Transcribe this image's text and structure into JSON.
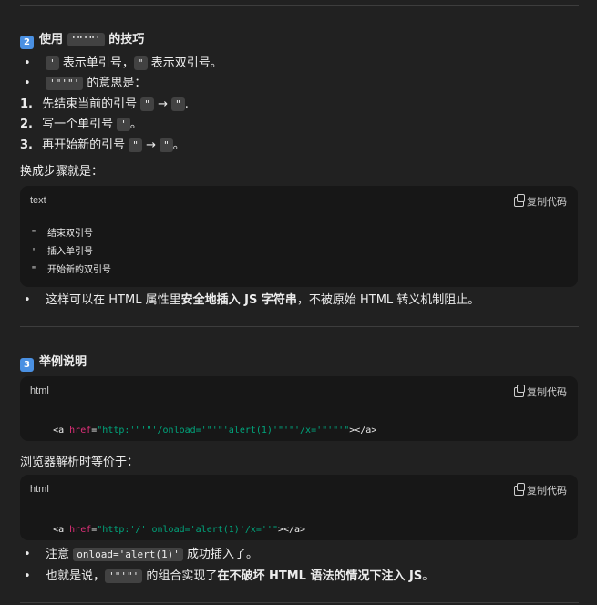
{
  "section2": {
    "badge": "2",
    "title_pre": "使用",
    "title_code": "'\"'\"'",
    "title_post": "的技巧",
    "bullets": [
      {
        "code": "'",
        "text": "表示单引号，",
        "code2": "\"",
        "text2": "表示双引号。"
      },
      {
        "code": "'\"'\"'",
        "text": "的意思是："
      }
    ],
    "steps": [
      {
        "num": "1.",
        "pre": "先结束当前的引号",
        "code": "\"",
        "arrow": "→",
        "code2": "\"",
        "post": "."
      },
      {
        "num": "2.",
        "pre": "写一个单引号",
        "code": "'",
        "post": "。"
      },
      {
        "num": "3.",
        "pre": "再开始新的引号",
        "code": "\"",
        "arrow": "→",
        "code2": "\"",
        "post": "。"
      }
    ],
    "summary_label": "换成步骤就是：",
    "code_block": {
      "lang": "text",
      "copy_label": "复制代码",
      "lines": [
        "\"  结束双引号",
        "'  插入单引号",
        "\"  开始新的双引号"
      ]
    },
    "bullet3_pre": "这样可以在 HTML 属性里",
    "bullet3_bold": "安全地插入 JS 字符串",
    "bullet3_post": "，不被原始 HTML 转义机制阻止。"
  },
  "section3": {
    "badge": "3",
    "title": "举例说明",
    "code1": {
      "lang": "html",
      "copy_label": "复制代码",
      "tokens": [
        {
          "t": "<a ",
          "c": "tag"
        },
        {
          "t": "href",
          "c": "attr"
        },
        {
          "t": "=",
          "c": "tag"
        },
        {
          "t": "\"http:'\"'\"'/onload='\"'\"'alert(1)'\"'\"'/x='\"'\"'\"",
          "c": "str"
        },
        {
          "t": "></a>",
          "c": "tag"
        }
      ]
    },
    "equiv_label": "浏览器解析时等价于：",
    "code2": {
      "lang": "html",
      "copy_label": "复制代码",
      "tokens": [
        {
          "t": "<a ",
          "c": "tag"
        },
        {
          "t": "href",
          "c": "attr"
        },
        {
          "t": "=",
          "c": "tag"
        },
        {
          "t": "\"http:'/' onload='alert(1)'/x=''\"",
          "c": "str"
        },
        {
          "t": "></a>",
          "c": "tag"
        }
      ]
    },
    "note1_pre": "注意",
    "note1_code": "onload='alert(1)'",
    "note1_post": "成功插入了。",
    "note2_pre": "也就是说，",
    "note2_code": "'\"'\"'",
    "note2_mid": "的组合实现了",
    "note2_bold": "在不破坏 HTML 语法的情况下注入 JS",
    "note2_post": "。"
  }
}
